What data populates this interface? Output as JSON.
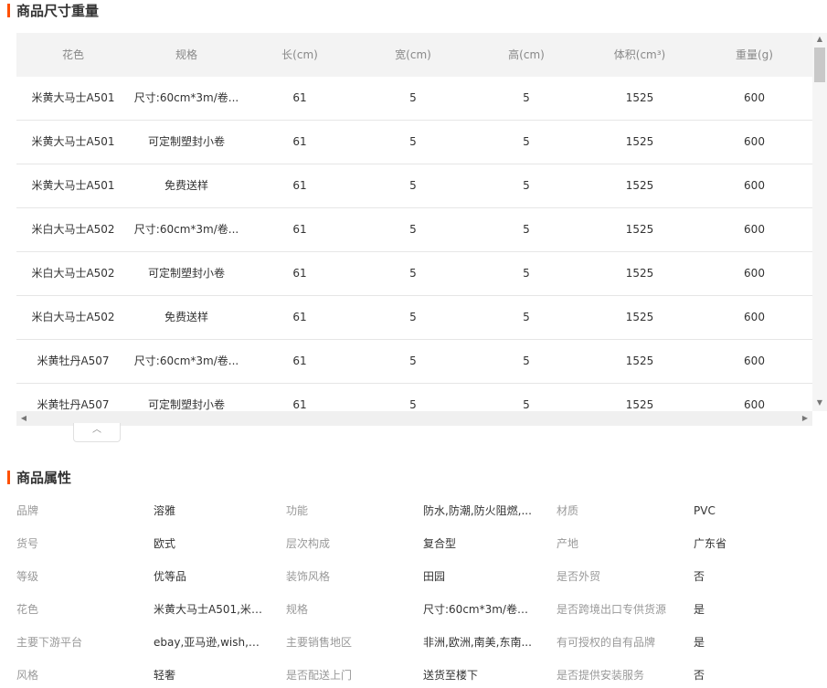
{
  "size_section": {
    "title": "商品尺寸重量"
  },
  "size_table": {
    "headers": [
      "花色",
      "规格",
      "长(cm)",
      "宽(cm)",
      "高(cm)",
      "体积(cm³)",
      "重量(g)"
    ],
    "rows": [
      [
        "米黄大马士A501",
        "尺寸:60cm*3m/卷...",
        "61",
        "5",
        "5",
        "1525",
        "600"
      ],
      [
        "米黄大马士A501",
        "可定制塑封小卷",
        "61",
        "5",
        "5",
        "1525",
        "600"
      ],
      [
        "米黄大马士A501",
        "免费送样",
        "61",
        "5",
        "5",
        "1525",
        "600"
      ],
      [
        "米白大马士A502",
        "尺寸:60cm*3m/卷...",
        "61",
        "5",
        "5",
        "1525",
        "600"
      ],
      [
        "米白大马士A502",
        "可定制塑封小卷",
        "61",
        "5",
        "5",
        "1525",
        "600"
      ],
      [
        "米白大马士A502",
        "免费送样",
        "61",
        "5",
        "5",
        "1525",
        "600"
      ],
      [
        "米黄牡丹A507",
        "尺寸:60cm*3m/卷...",
        "61",
        "5",
        "5",
        "1525",
        "600"
      ],
      [
        "米黄牡丹A507",
        "可定制塑封小卷",
        "61",
        "5",
        "5",
        "1525",
        "600"
      ]
    ]
  },
  "attr_section": {
    "title": "商品属性"
  },
  "attributes": [
    [
      [
        "品牌",
        "溶雅"
      ],
      [
        "功能",
        "防水,防潮,防火阻燃,..."
      ],
      [
        "材质",
        "PVC"
      ]
    ],
    [
      [
        "货号",
        "欧式"
      ],
      [
        "层次构成",
        "复合型"
      ],
      [
        "产地",
        "广东省"
      ]
    ],
    [
      [
        "等级",
        "优等品"
      ],
      [
        "装饰风格",
        "田园"
      ],
      [
        "是否外贸",
        "否"
      ]
    ],
    [
      [
        "花色",
        "米黄大马士A501,米白..."
      ],
      [
        "规格",
        "尺寸:60cm*3m/卷（..."
      ],
      [
        "是否跨境出口专供货源",
        "是"
      ]
    ],
    [
      [
        "主要下游平台",
        "ebay,亚马逊,wish,速..."
      ],
      [
        "主要销售地区",
        "非洲,欧洲,南美,东南..."
      ],
      [
        "有可授权的自有品牌",
        "是"
      ]
    ],
    [
      [
        "风格",
        "轻奢"
      ],
      [
        "是否配送上门",
        "送货至楼下"
      ],
      [
        "是否提供安装服务",
        "否"
      ]
    ]
  ]
}
